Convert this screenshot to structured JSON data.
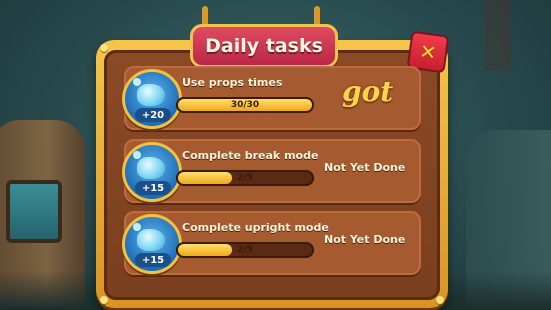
{
  "dialog": {
    "title": "Daily tasks",
    "close_label": "✕"
  },
  "tasks": [
    {
      "label": "Use props times",
      "reward": "+20",
      "progress_text": "30/30",
      "progress_fraction": 1.0,
      "status": "got",
      "reward_icon": "blue-gem-icon"
    },
    {
      "label": "Complete break mode",
      "reward": "+15",
      "progress_text": "2/5",
      "progress_fraction": 0.4,
      "status": "Not Yet Done",
      "reward_icon": "blue-gem-icon"
    },
    {
      "label": "Complete upright mode",
      "reward": "+15",
      "progress_text": "2/5",
      "progress_fraction": 0.4,
      "status": "Not Yet Done",
      "reward_icon": "blue-gem-icon"
    }
  ],
  "colors": {
    "panel_frame": "#f6c64a",
    "panel_body": "#8a4a26",
    "title_banner": "#e04a63",
    "progress_fill": "#f0a818",
    "close_button": "#ef3c4c"
  }
}
